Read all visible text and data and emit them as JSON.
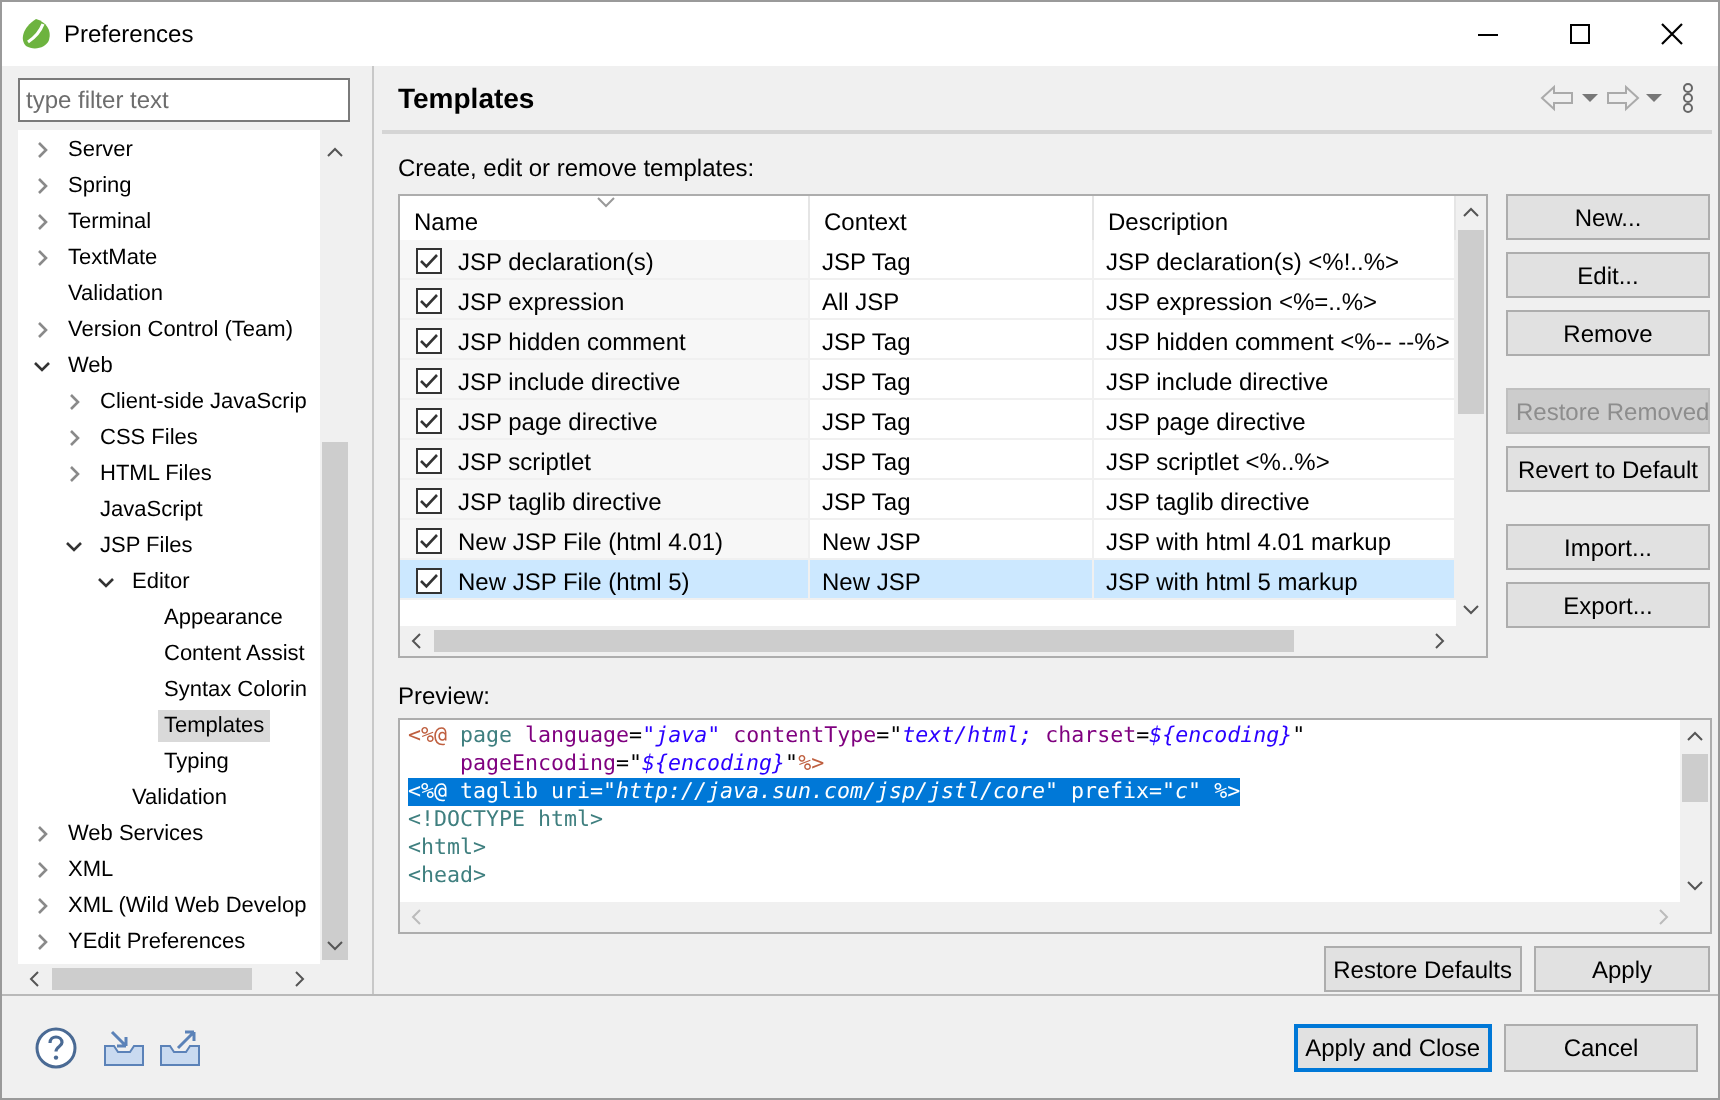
{
  "window": {
    "title": "Preferences"
  },
  "filter": {
    "placeholder": "type filter text"
  },
  "tree": [
    {
      "label": "Server",
      "expanded": false,
      "selected": false
    },
    {
      "label": "Spring",
      "expanded": false,
      "selected": false
    },
    {
      "label": "Terminal",
      "expanded": false,
      "selected": false
    },
    {
      "label": "TextMate",
      "expanded": false,
      "selected": false
    },
    {
      "label": "Validation",
      "selected": false
    },
    {
      "label": "Version Control (Team)",
      "expanded": false,
      "selected": false
    },
    {
      "label": "Web",
      "expanded": true,
      "selected": false,
      "children": [
        {
          "label": "Client-side JavaScrip",
          "expanded": false,
          "selected": false
        },
        {
          "label": "CSS Files",
          "expanded": false,
          "selected": false
        },
        {
          "label": "HTML Files",
          "expanded": false,
          "selected": false
        },
        {
          "label": "JavaScript",
          "selected": false
        },
        {
          "label": "JSP Files",
          "expanded": true,
          "selected": false,
          "children": [
            {
              "label": "Editor",
              "expanded": true,
              "selected": false,
              "children": [
                {
                  "label": "Appearance",
                  "selected": false
                },
                {
                  "label": "Content Assist",
                  "selected": false
                },
                {
                  "label": "Syntax Colorin",
                  "selected": false
                },
                {
                  "label": "Templates",
                  "selected": true
                },
                {
                  "label": "Typing",
                  "selected": false
                }
              ]
            },
            {
              "label": "Validation",
              "selected": false
            }
          ]
        }
      ]
    },
    {
      "label": "Web Services",
      "expanded": false,
      "selected": false
    },
    {
      "label": "XML",
      "expanded": false,
      "selected": false
    },
    {
      "label": "XML (Wild Web Develop",
      "expanded": false,
      "selected": false
    },
    {
      "label": "YEdit Preferences",
      "expanded": false,
      "selected": false
    }
  ],
  "page": {
    "title": "Templates",
    "intro": "Create, edit or remove templates:"
  },
  "table": {
    "columns": [
      "Name",
      "Context",
      "Description"
    ],
    "rows": [
      {
        "name": "JSP declaration(s)",
        "context": "JSP Tag",
        "description": "JSP declaration(s) <%!..%>",
        "checked": true,
        "selected": false
      },
      {
        "name": "JSP expression",
        "context": "All JSP",
        "description": "JSP expression <%=..%>",
        "checked": true,
        "selected": false
      },
      {
        "name": "JSP hidden comment",
        "context": "JSP Tag",
        "description": "JSP hidden comment <%-- --%>",
        "checked": true,
        "selected": false
      },
      {
        "name": "JSP include directive",
        "context": "JSP Tag",
        "description": "JSP include directive",
        "checked": true,
        "selected": false
      },
      {
        "name": "JSP page directive",
        "context": "JSP Tag",
        "description": "JSP page directive",
        "checked": true,
        "selected": false
      },
      {
        "name": "JSP scriptlet",
        "context": "JSP Tag",
        "description": "JSP scriptlet <%..%>",
        "checked": true,
        "selected": false
      },
      {
        "name": "JSP taglib directive",
        "context": "JSP Tag",
        "description": "JSP taglib directive",
        "checked": true,
        "selected": false
      },
      {
        "name": "New JSP File (html 4.01)",
        "context": "New JSP",
        "description": "JSP with html 4.01 markup",
        "checked": true,
        "selected": false
      },
      {
        "name": "New JSP File (html 5)",
        "context": "New JSP",
        "description": "JSP with html 5 markup",
        "checked": true,
        "selected": true
      }
    ]
  },
  "side_buttons": [
    {
      "buttons": [
        {
          "label": "New...",
          "disabled": false
        },
        {
          "label": "Edit...",
          "disabled": false
        },
        {
          "label": "Remove",
          "disabled": false
        }
      ]
    },
    {
      "buttons": [
        {
          "label": "Restore Removed",
          "disabled": true
        },
        {
          "label": "Revert to Default",
          "disabled": false
        }
      ]
    },
    {
      "buttons": [
        {
          "label": "Import...",
          "disabled": false
        },
        {
          "label": "Export...",
          "disabled": false
        }
      ]
    }
  ],
  "preview": {
    "label": "Preview:",
    "lines": [
      {
        "selected": false,
        "tokens": [
          {
            "text": "<%@",
            "kind": "delim"
          },
          {
            "text": " page ",
            "kind": "tag"
          },
          {
            "text": "language",
            "kind": "attr"
          },
          {
            "text": "=",
            "kind": "plain"
          },
          {
            "text": "\"java\"",
            "kind": "value"
          },
          {
            "text": " contentType",
            "kind": "attr"
          },
          {
            "text": "=\"",
            "kind": "plain"
          },
          {
            "text": "text/html; ",
            "kind": "value"
          },
          {
            "text": "charset",
            "kind": "attr"
          },
          {
            "text": "=",
            "kind": "plain"
          },
          {
            "text": "${encoding}",
            "kind": "value"
          },
          {
            "text": "\"",
            "kind": "plain"
          }
        ]
      },
      {
        "selected": false,
        "tokens": [
          {
            "text": "    pageEncoding",
            "kind": "attr"
          },
          {
            "text": "=\"",
            "kind": "plain"
          },
          {
            "text": "${encoding}",
            "kind": "value"
          },
          {
            "text": "\"",
            "kind": "plain"
          },
          {
            "text": "%>",
            "kind": "delim"
          }
        ]
      },
      {
        "selected": true,
        "tokens": [
          {
            "text": "<%@ taglib uri=",
            "kind": "plain"
          },
          {
            "text": "\"http://java.sun.com/jsp/jstl/core\"",
            "kind": "value"
          },
          {
            "text": " prefix=",
            "kind": "plain"
          },
          {
            "text": "\"c\"",
            "kind": "value"
          },
          {
            "text": " %>",
            "kind": "plain"
          }
        ]
      },
      {
        "selected": false,
        "tokens": [
          {
            "text": "<!DOCTYPE html>",
            "kind": "tag"
          }
        ]
      },
      {
        "selected": false,
        "tokens": [
          {
            "text": "<html>",
            "kind": "tag"
          }
        ]
      },
      {
        "selected": false,
        "tokens": [
          {
            "text": "<head>",
            "kind": "tag"
          }
        ]
      }
    ]
  },
  "page_buttons": [
    "Restore Defaults",
    "Apply"
  ],
  "footer_buttons": [
    {
      "label": "Apply and Close",
      "default": true
    },
    {
      "label": "Cancel",
      "default": false
    }
  ]
}
